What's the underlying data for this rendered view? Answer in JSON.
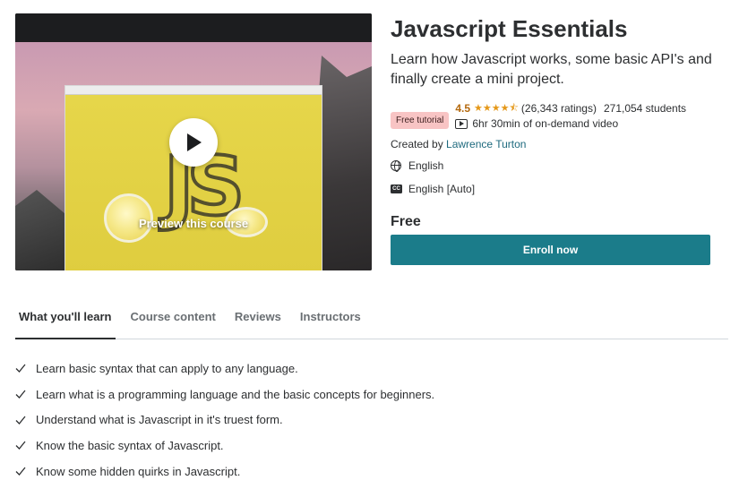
{
  "preview": {
    "label": "Preview this course",
    "logo_text": "JS"
  },
  "course": {
    "title": "Javascript Essentials",
    "subtitle": "Learn how Javascript works, some basic API's and finally create a mini project.",
    "badge": "Free tutorial",
    "rating": "4.5",
    "stars": "★★★★⯪",
    "ratings_count": "(26,343 ratings)",
    "students": "271,054 students",
    "video_length": "6hr 30min of on-demand video",
    "created_by_label": "Created by",
    "instructor": "Lawrence Turton",
    "language": "English",
    "captions": "English [Auto]",
    "captions_icon_text": "CC",
    "price": "Free",
    "enroll_label": "Enroll now"
  },
  "tabs": [
    {
      "label": "What you'll learn",
      "active": true
    },
    {
      "label": "Course content",
      "active": false
    },
    {
      "label": "Reviews",
      "active": false
    },
    {
      "label": "Instructors",
      "active": false
    }
  ],
  "learn_items": [
    "Learn basic syntax that can apply to any language.",
    "Learn what is a programming language and the basic concepts for beginners.",
    "Understand what is Javascript in it's truest form.",
    "Know the basic syntax of Javascript.",
    "Know some hidden quirks in Javascript."
  ],
  "colors": {
    "accent": "#1b7c8a",
    "link": "#1e6a7e",
    "rating": "#b4690e",
    "star": "#e59819",
    "badge_bg": "#f8c4c4"
  }
}
